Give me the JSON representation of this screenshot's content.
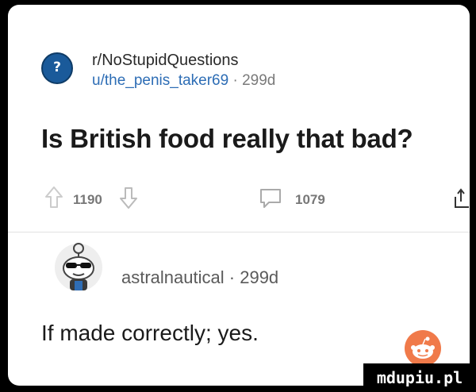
{
  "post": {
    "subreddit": "r/NoStupidQuestions",
    "author": "u/the_penis_taker69",
    "separator": "·",
    "age": "299d",
    "title": "Is British food really that bad?",
    "upvotes": "1190",
    "comments": "1079"
  },
  "comment": {
    "author": "astralnautical",
    "separator": "·",
    "age": "299d",
    "body": "If made correctly; yes."
  },
  "watermark": {
    "text": "mdupiu.pl"
  },
  "colors": {
    "background": "#000000",
    "card": "#ffffff",
    "username": "#2d6db5",
    "snoo": "#f07a4a"
  }
}
